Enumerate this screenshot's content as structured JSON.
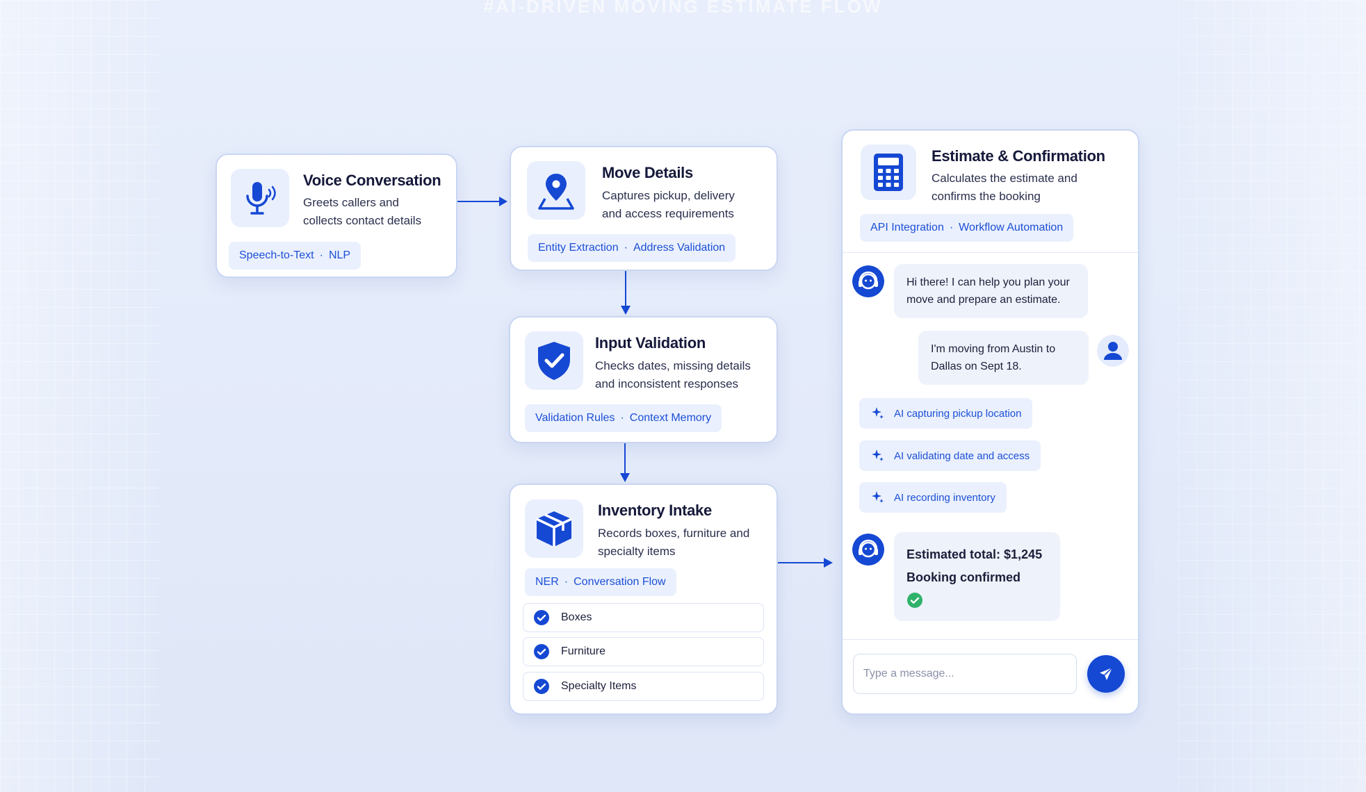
{
  "header": {
    "faded_title": "#AI-DRIVEN MOVING ESTIMATE FLOW"
  },
  "voice": {
    "title": "Voice Conversation",
    "desc_line1": "Greets callers and",
    "desc_line2": "collects contact details",
    "tags": [
      "Speech-to-Text",
      "NLP"
    ]
  },
  "move": {
    "title": "Move Details",
    "desc_line1": "Captures pickup, delivery",
    "desc_line2": "and access requirements",
    "tags": [
      "Entity Extraction",
      "Address Validation"
    ]
  },
  "validation": {
    "title": "Input Validation",
    "desc_line1": "Checks dates, missing details",
    "desc_line2": "and inconsistent responses",
    "tags": [
      "Validation Rules",
      "Context Memory"
    ]
  },
  "inventory": {
    "title": "Inventory Intake",
    "desc_line1": "Records boxes, furniture and",
    "desc_line2": "specialty items",
    "tags": [
      "NER",
      "Conversation Flow"
    ],
    "items": [
      "Boxes",
      "Furniture",
      "Specialty Items"
    ]
  },
  "estimate": {
    "title": "Estimate & Confirmation",
    "desc_line1": "Calculates the estimate and",
    "desc_line2": "confirms the booking",
    "tags": [
      "API Integration",
      "Workflow Automation"
    ]
  },
  "chat": {
    "bot_msg_line1": "Hi there! I can help you plan your",
    "bot_msg_line2": "move and prepare an estimate.",
    "user_msg_line1": "I'm moving from Austin to",
    "user_msg_line2": "Dallas on Sept 18.",
    "status_items": [
      "AI capturing pickup location",
      "AI validating date and access",
      "AI recording inventory"
    ],
    "result_line1": "Estimated total: $1,245",
    "result_line2": "Booking confirmed",
    "input_placeholder": "Type a message..."
  },
  "colors": {
    "accent": "#1548d3",
    "tag_bg": "#eaf0fd",
    "success": "#2fb36b"
  }
}
